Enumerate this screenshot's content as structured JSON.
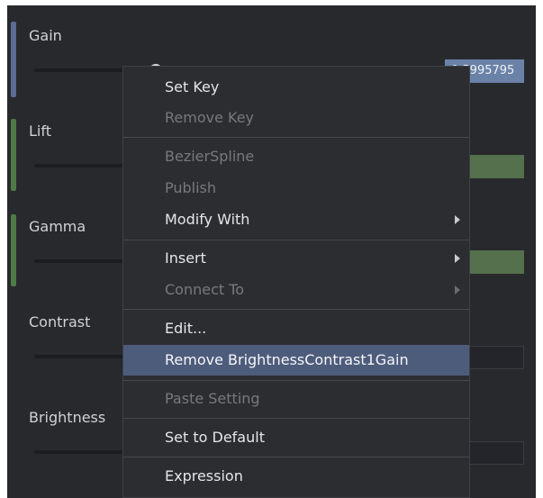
{
  "params": [
    {
      "label": "Gain",
      "value": "0.5995795",
      "bar_color": "#5b6b96"
    },
    {
      "label": "Lift",
      "value": "",
      "bar_color": "#4e7a48"
    },
    {
      "label": "Gamma",
      "value": "",
      "bar_color": "#4e7a48"
    },
    {
      "label": "Contrast",
      "value": ""
    },
    {
      "label": "Brightness",
      "value": ""
    }
  ],
  "menu": {
    "items": [
      {
        "label": "Set Key",
        "enabled": true
      },
      {
        "label": "Remove Key",
        "enabled": false
      },
      {
        "label": "BezierSpline",
        "enabled": false
      },
      {
        "label": "Publish",
        "enabled": false
      },
      {
        "label": "Modify With",
        "enabled": true,
        "submenu": true
      },
      {
        "label": "Insert",
        "enabled": true,
        "submenu": true
      },
      {
        "label": "Connect To",
        "enabled": false,
        "submenu": true
      },
      {
        "label": "Edit...",
        "enabled": true
      },
      {
        "label": "Remove BrightnessContrast1Gain",
        "enabled": true,
        "highlighted": true
      },
      {
        "label": "Paste Setting",
        "enabled": false
      },
      {
        "label": "Set to Default",
        "enabled": true
      },
      {
        "label": "Expression",
        "enabled": true
      }
    ]
  },
  "colors": {
    "panel_bg": "#28292d",
    "menu_bg": "#2c2d31",
    "highlight": "#4e5c7c",
    "gain_value_bg": "#6a82a8",
    "green_value_bg": "#55704c"
  },
  "icons": [
    "submenu-arrow-icon"
  ]
}
